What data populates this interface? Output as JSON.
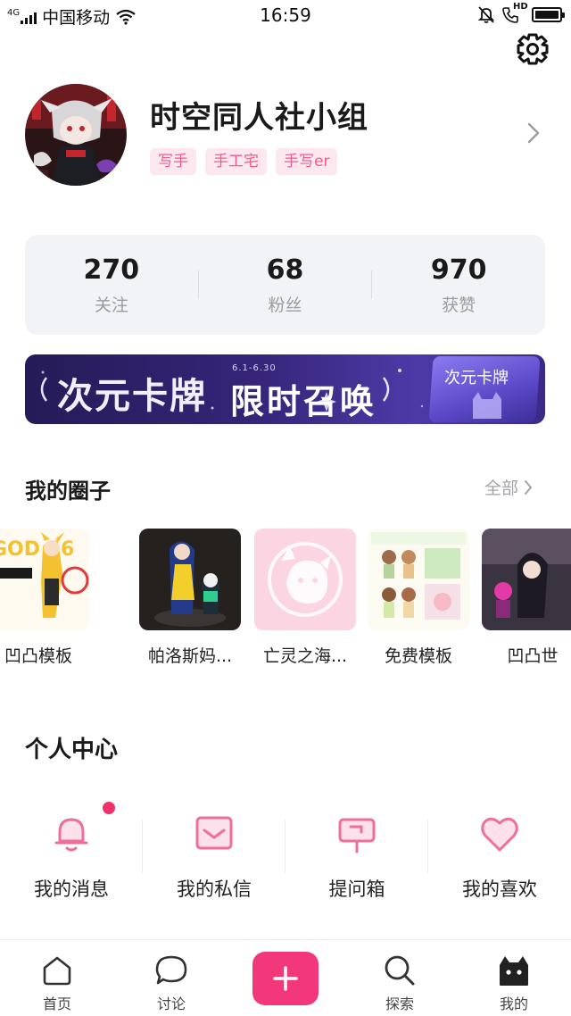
{
  "status_bar": {
    "network_type": "4G",
    "carrier": "中国移动",
    "time": "16:59",
    "hd_label": "HD",
    "battery_level": 1.0
  },
  "header": {
    "settings_icon": "gear-icon"
  },
  "profile": {
    "name": "时空同人社小组",
    "tags": [
      "写手",
      "手工宅",
      "手写er"
    ],
    "chevron_icon": "chevron-right-icon"
  },
  "stats": [
    {
      "value": "270",
      "label": "关注"
    },
    {
      "value": "68",
      "label": "粉丝"
    },
    {
      "value": "970",
      "label": "获赞"
    }
  ],
  "banner": {
    "title": "次元卡牌",
    "date": "6.1-6.30",
    "subtitle": "限时召唤",
    "card_title": "次元卡牌"
  },
  "circles": {
    "title": "我的圈子",
    "see_all": "全部",
    "items": [
      {
        "label": "凹凸模板"
      },
      {
        "label": "帕洛斯妈..."
      },
      {
        "label": "亡灵之海..."
      },
      {
        "label": "免费模板"
      },
      {
        "label": "凹凸世"
      }
    ]
  },
  "personal_center": {
    "title": "个人中心",
    "items": [
      {
        "label": "我的消息",
        "icon": "bell-icon"
      },
      {
        "label": "我的私信",
        "icon": "envelope-icon"
      },
      {
        "label": "提问箱",
        "icon": "mailbox-icon"
      },
      {
        "label": "我的喜欢",
        "icon": "heart-icon"
      }
    ]
  },
  "bottom_nav": {
    "items": [
      {
        "label": "首页",
        "icon": "home-icon"
      },
      {
        "label": "讨论",
        "icon": "chat-bubble-icon"
      },
      {
        "label": "探索",
        "icon": "search-icon"
      },
      {
        "label": "我的",
        "icon": "cat-profile-icon"
      }
    ],
    "add_icon": "plus-icon"
  },
  "colors": {
    "accent": "#f2377a",
    "tag_bg": "#fde8ef",
    "tag_text": "#ef5c8b",
    "stats_bg": "#f2f3f7",
    "icon_pink": "#f06f98"
  }
}
